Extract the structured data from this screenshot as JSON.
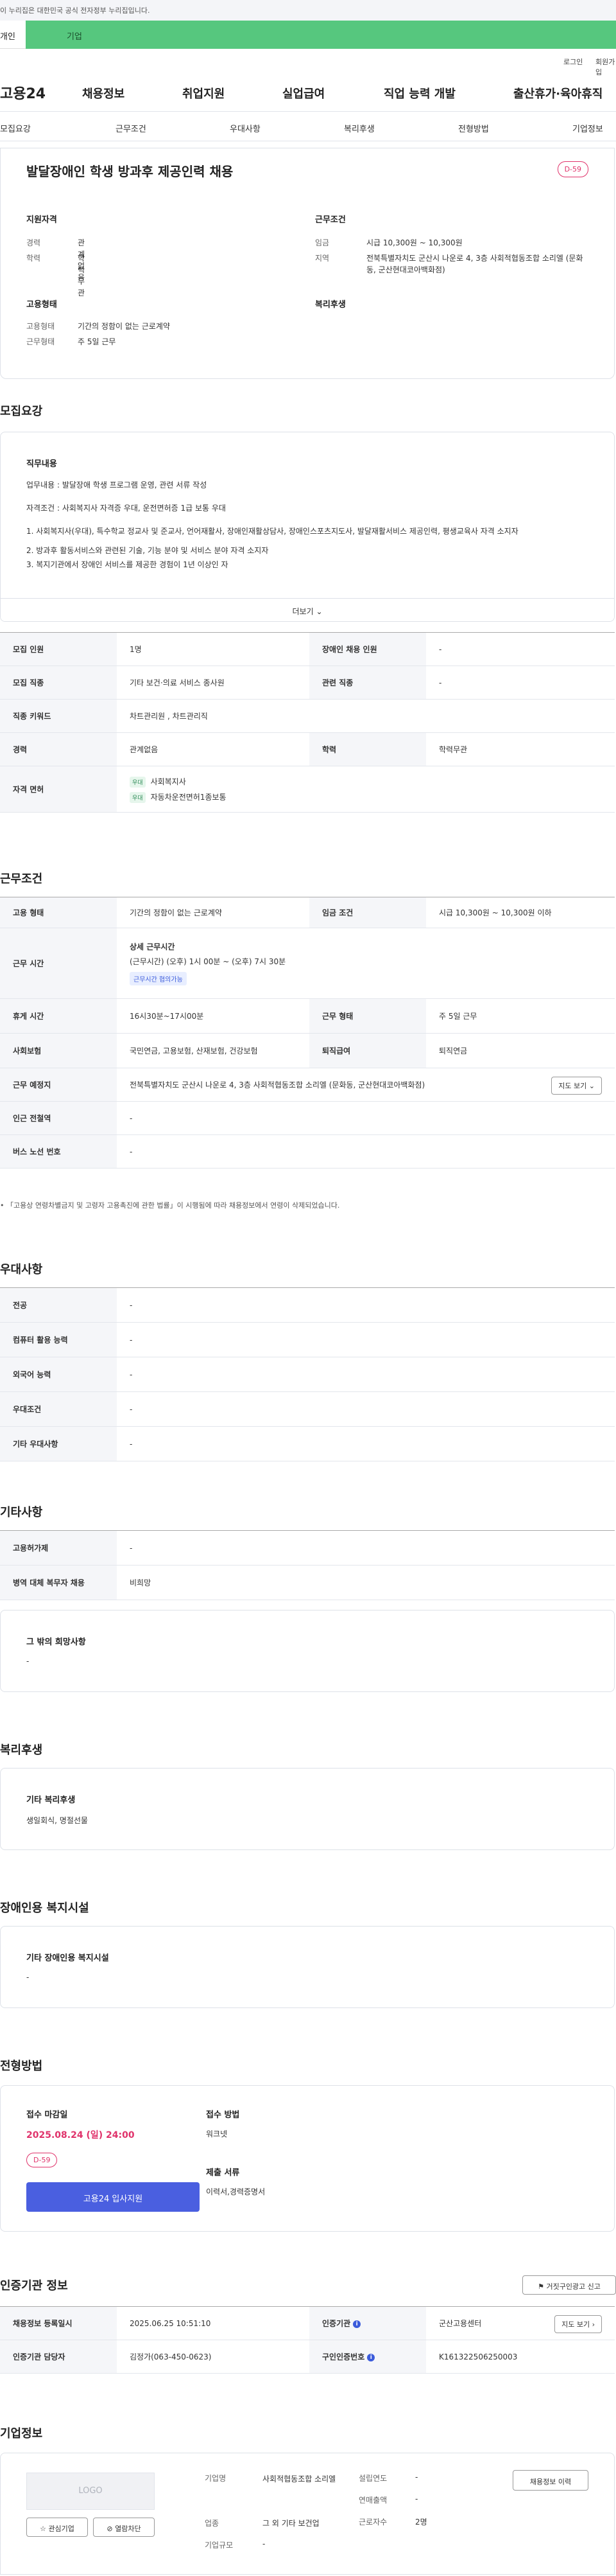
{
  "gov_banner": "이 누리집은 대한민국 공식 전자정부 누리집입니다.",
  "user_tabs": {
    "person": "개인",
    "company": "기업"
  },
  "util_links": {
    "login": "로그인",
    "signup": "회원가입"
  },
  "gnb": {
    "logo": "고용24",
    "menus": [
      "채용정보",
      "취업지원",
      "실업급여",
      "직업 능력 개발",
      "출산휴가·육아휴직"
    ]
  },
  "anchor_tabs": [
    "모집요강",
    "근무조건",
    "우대사항",
    "복리후생",
    "전형방법",
    "기업정보"
  ],
  "job": {
    "title": "발달장애인 학생 방과후 제공인력 채용",
    "dday": "D-59",
    "qual_title": "지원자격",
    "qual": [
      {
        "k": "경력",
        "v": "관계없음"
      },
      {
        "k": "학력",
        "v": "학력무관"
      }
    ],
    "work_title": "근무조건",
    "work": [
      {
        "k": "임금",
        "v": "시급 10,300원 ~ 10,300원"
      },
      {
        "k": "지역",
        "v": "전북특별자치도 군산시 나운로 4, 3층 사회적협동조합 소리엘 (문화동, 군산현대코아백화점)"
      }
    ],
    "emp_title": "고용형태",
    "emp": [
      {
        "k": "고용형태",
        "v": "기간의 정함이 없는 근로계약"
      },
      {
        "k": "근무형태",
        "v": "주 5일 근무"
      }
    ],
    "welfare_title": "복리후생"
  },
  "recruit": {
    "title": "모집요강",
    "duty_title": "직무내용",
    "duty_lines": [
      "업무내용 : 발달장애 학생 프로그램 운영, 관련 서류 작성",
      "자격조건 : 사회복지사 자격증 우대, 운전면허증 1급 보통 우대",
      "1. 사회복지사(우대), 특수학교 정교사 및 준교사, 언어재활사, 장애인재활상담사, 장애인스포츠지도사, 발달재활서비스 제공인력, 평생교육사 자격 소지자",
      "2. 방과후 활동서비스와 관련된 기술, 기능 분야 및 서비스 분야 자격 소지자",
      "3. 복지기관에서 장애인 서비스를 제공한 경험이 1년 이상인 자"
    ],
    "more_label": "더보기",
    "rows": [
      {
        "c": [
          {
            "th": "모집 인원"
          },
          {
            "td": "1명"
          },
          {
            "th": "장애인 채용 인원"
          },
          {
            "td": "-"
          }
        ]
      },
      {
        "c": [
          {
            "th": "모집 직종"
          },
          {
            "td": "기타 보건·의료 서비스 종사원"
          },
          {
            "th": "관련 직종"
          },
          {
            "td": "-"
          }
        ]
      },
      {
        "c": [
          {
            "th": "직종 키워드"
          },
          {
            "td": "차트관리원 , 차트관리직"
          }
        ]
      },
      {
        "c": [
          {
            "th": "경력"
          },
          {
            "td": "관계없음"
          },
          {
            "th": "학력"
          },
          {
            "td": "학력무관"
          }
        ]
      }
    ],
    "license": {
      "th": "자격 면허",
      "items": [
        {
          "badge": "우대",
          "name": "사회복지사"
        },
        {
          "badge": "우대",
          "name": "자동차운전면허1종보통"
        }
      ]
    }
  },
  "work_cond": {
    "title": "근무조건",
    "emp_type": {
      "th": "고용 형태",
      "td": "기간의 정함이 없는 근로계약"
    },
    "wage": {
      "th": "임금 조건",
      "td": "시급 10,300원 ~ 10,300원 이하"
    },
    "hours": {
      "th": "근무 시간",
      "sub": "상세 근무시간",
      "detail": "(근무시간) (오후) 1시 00분 ~ (오후) 7시 30분",
      "badge": "근무시간 협의가능"
    },
    "rest": {
      "th": "휴게 시간",
      "td": "16시30분~17시00분"
    },
    "work_form": {
      "th": "근무 형태",
      "td": "주 5일 근무"
    },
    "insurance": {
      "th": "사회보험",
      "td": "국민연금, 고용보험, 산재보험, 건강보험"
    },
    "retire": {
      "th": "퇴직급여",
      "td": "퇴직연금"
    },
    "place": {
      "th": "근무 예정지",
      "td": "전북특별자치도 군산시 나운로 4, 3층 사회적협동조합 소리엘 (문화동, 군산현대코아백화점)",
      "map_btn": "지도 보기"
    },
    "station": {
      "th": "인근 전철역",
      "td": "-"
    },
    "bus": {
      "th": "버스 노선 번호",
      "td": "-"
    },
    "notice": "「고용상 연령차별금지 및 고령자 고용촉진에 관한 법률」이 시행됨에 따라 채용정보에서 연령이 삭제되었습니다."
  },
  "prefer": {
    "title": "우대사항",
    "rows": [
      {
        "th": "전공",
        "td": "-"
      },
      {
        "th": "컴퓨터 활용 능력",
        "td": "-"
      },
      {
        "th": "외국어 능력",
        "td": "-"
      },
      {
        "th": "우대조건",
        "td": "-"
      },
      {
        "th": "기타 우대사항",
        "td": "-"
      }
    ]
  },
  "etc": {
    "title": "기타사항",
    "rows": [
      {
        "th": "고용허가제",
        "td": "-"
      },
      {
        "th": "병역 대체 복무자 채용",
        "td": "비희망"
      }
    ],
    "other_title": "그 밖의 희망사항",
    "other_value": "-"
  },
  "welfare": {
    "title": "복리후생",
    "sub": "기타 복리후생",
    "value": "생일회식, 명절선물"
  },
  "disability": {
    "title": "장애인용 복지시설",
    "sub": "기타 장애인용 복지시설",
    "value": "-"
  },
  "apply": {
    "title": "전형방법",
    "deadline_label": "접수 마감일",
    "deadline": "2025.08.24 (일) 24:00",
    "dday": "D-59",
    "button": "고용24 입사지원",
    "method_label": "접수 방법",
    "method": "워크넷",
    "docs_label": "제출 서류",
    "docs": "이력서,경력증명서"
  },
  "agency": {
    "title": "인증기관 정보",
    "report_btn": "거짓구인광고 신고",
    "reg_date": {
      "th": "채용정보 등록일시",
      "td": "2025.06.25 10:51:10"
    },
    "org": {
      "th": "인증기관",
      "td": "군산고용센터"
    },
    "map_btn": "지도 보기",
    "manager": {
      "th": "인증기관 담당자",
      "td": "김정가(063-450-0623)"
    },
    "auth_no": {
      "th": "구인인증번호",
      "td": "K161322506250003"
    }
  },
  "company": {
    "title": "기업정보",
    "logo": "LOGO",
    "fav_btn": "관심기업",
    "block_btn": "열람차단",
    "name_label": "기업명",
    "name": "사회적협동조합 소리엘",
    "industry_label": "업종",
    "industry": "그 외 기타 보건업",
    "size_label": "기업규모",
    "size": "-",
    "founded_label": "설립연도",
    "founded": "-",
    "revenue_label": "연매출액",
    "revenue": "-",
    "employees_label": "근로자수",
    "employees": "2명",
    "history_btn": "채용정보 이력"
  }
}
